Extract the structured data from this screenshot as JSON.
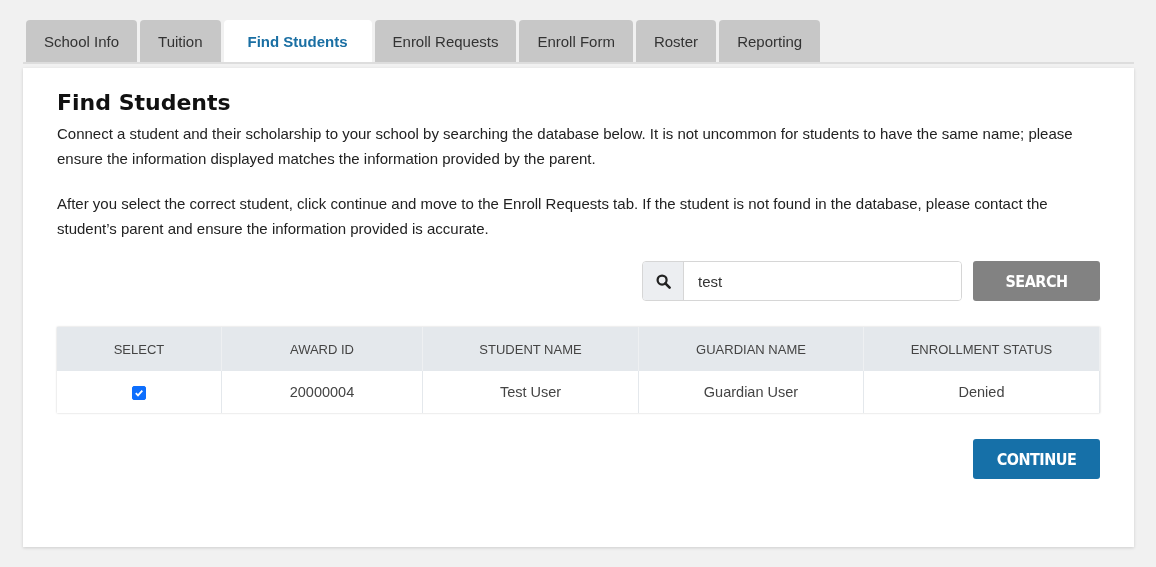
{
  "tabs": [
    {
      "label": "School Info",
      "selected": false
    },
    {
      "label": "Tuition",
      "selected": false
    },
    {
      "label": "Find Students",
      "selected": true
    },
    {
      "label": "Enroll Requests",
      "selected": false
    },
    {
      "label": "Enroll Form",
      "selected": false
    },
    {
      "label": "Roster",
      "selected": false
    },
    {
      "label": "Reporting",
      "selected": false
    }
  ],
  "heading": "Find Students",
  "paragraphs": [
    "Connect a student and their scholarship to your school by searching the database below. It is not uncommon for students to have the same name; please ensure the information displayed matches the information provided by the parent.",
    "After you select the correct student, click continue and move to the Enroll Requests tab. If the student is not found in the database, please contact the student’s parent and ensure the information provided is accurate."
  ],
  "search": {
    "value": "test",
    "button": "SEARCH"
  },
  "table": {
    "columns": [
      "SELECT",
      "AWARD ID",
      "STUDENT NAME",
      "GUARDIAN NAME",
      "ENROLLMENT STATUS"
    ],
    "rows": [
      {
        "cells": [
          {
            "kind": "checkbox",
            "checked": true
          },
          "20000004",
          "Test User",
          "Guardian User",
          "Denied"
        ]
      }
    ]
  },
  "continue_button": "CONTINUE"
}
